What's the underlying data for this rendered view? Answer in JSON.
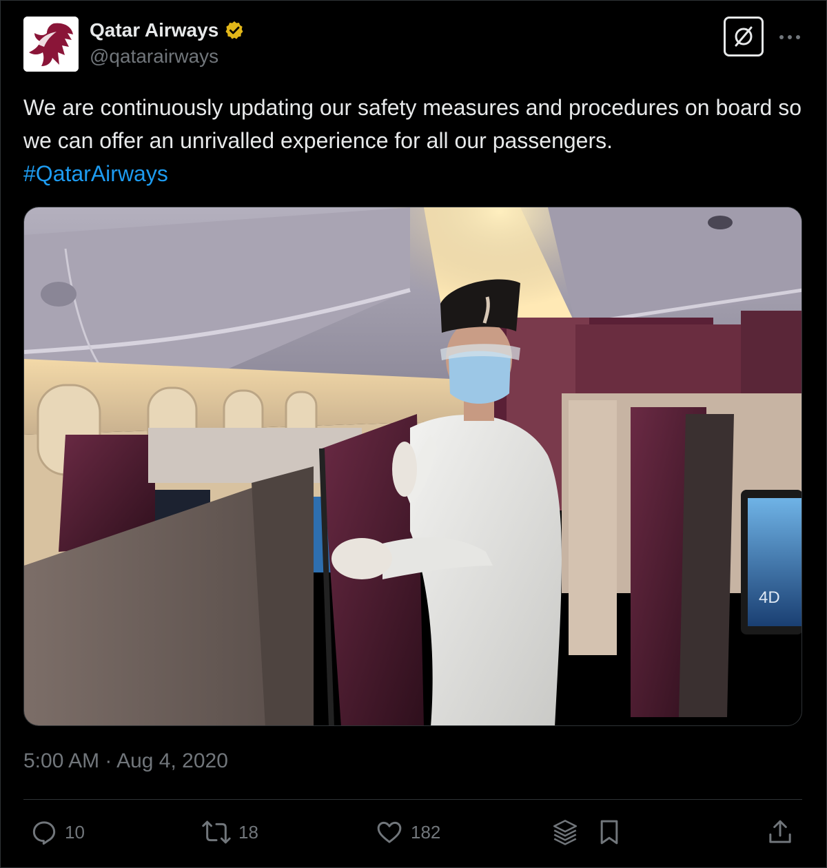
{
  "tweet": {
    "author": {
      "display_name": "Qatar Airways",
      "handle": "@qatarairways",
      "verified": true,
      "avatar_icon": "oryx-logo-icon",
      "brand_color": "#8a1538"
    },
    "text": "We are continuously updating our safety measures and procedures on board so we can offer an unrivalled experience for all our passengers.",
    "hashtag": "#QatarAirways",
    "image": {
      "seat_label": "4D"
    },
    "timestamp": "5:00 AM · Aug 4, 2020",
    "actions": {
      "replies": "10",
      "reposts": "18",
      "likes": "182"
    },
    "icons": {
      "grok": "grok-icon",
      "more": "more-options-icon",
      "reply": "reply-icon",
      "repost": "repost-icon",
      "like": "like-icon",
      "views": "layers-icon",
      "bookmark": "bookmark-icon",
      "share": "share-icon"
    },
    "colors": {
      "background": "#000000",
      "text": "#e7e9ea",
      "secondary": "#71767b",
      "link": "#1d9bf0",
      "verified": "#e2b719"
    }
  }
}
